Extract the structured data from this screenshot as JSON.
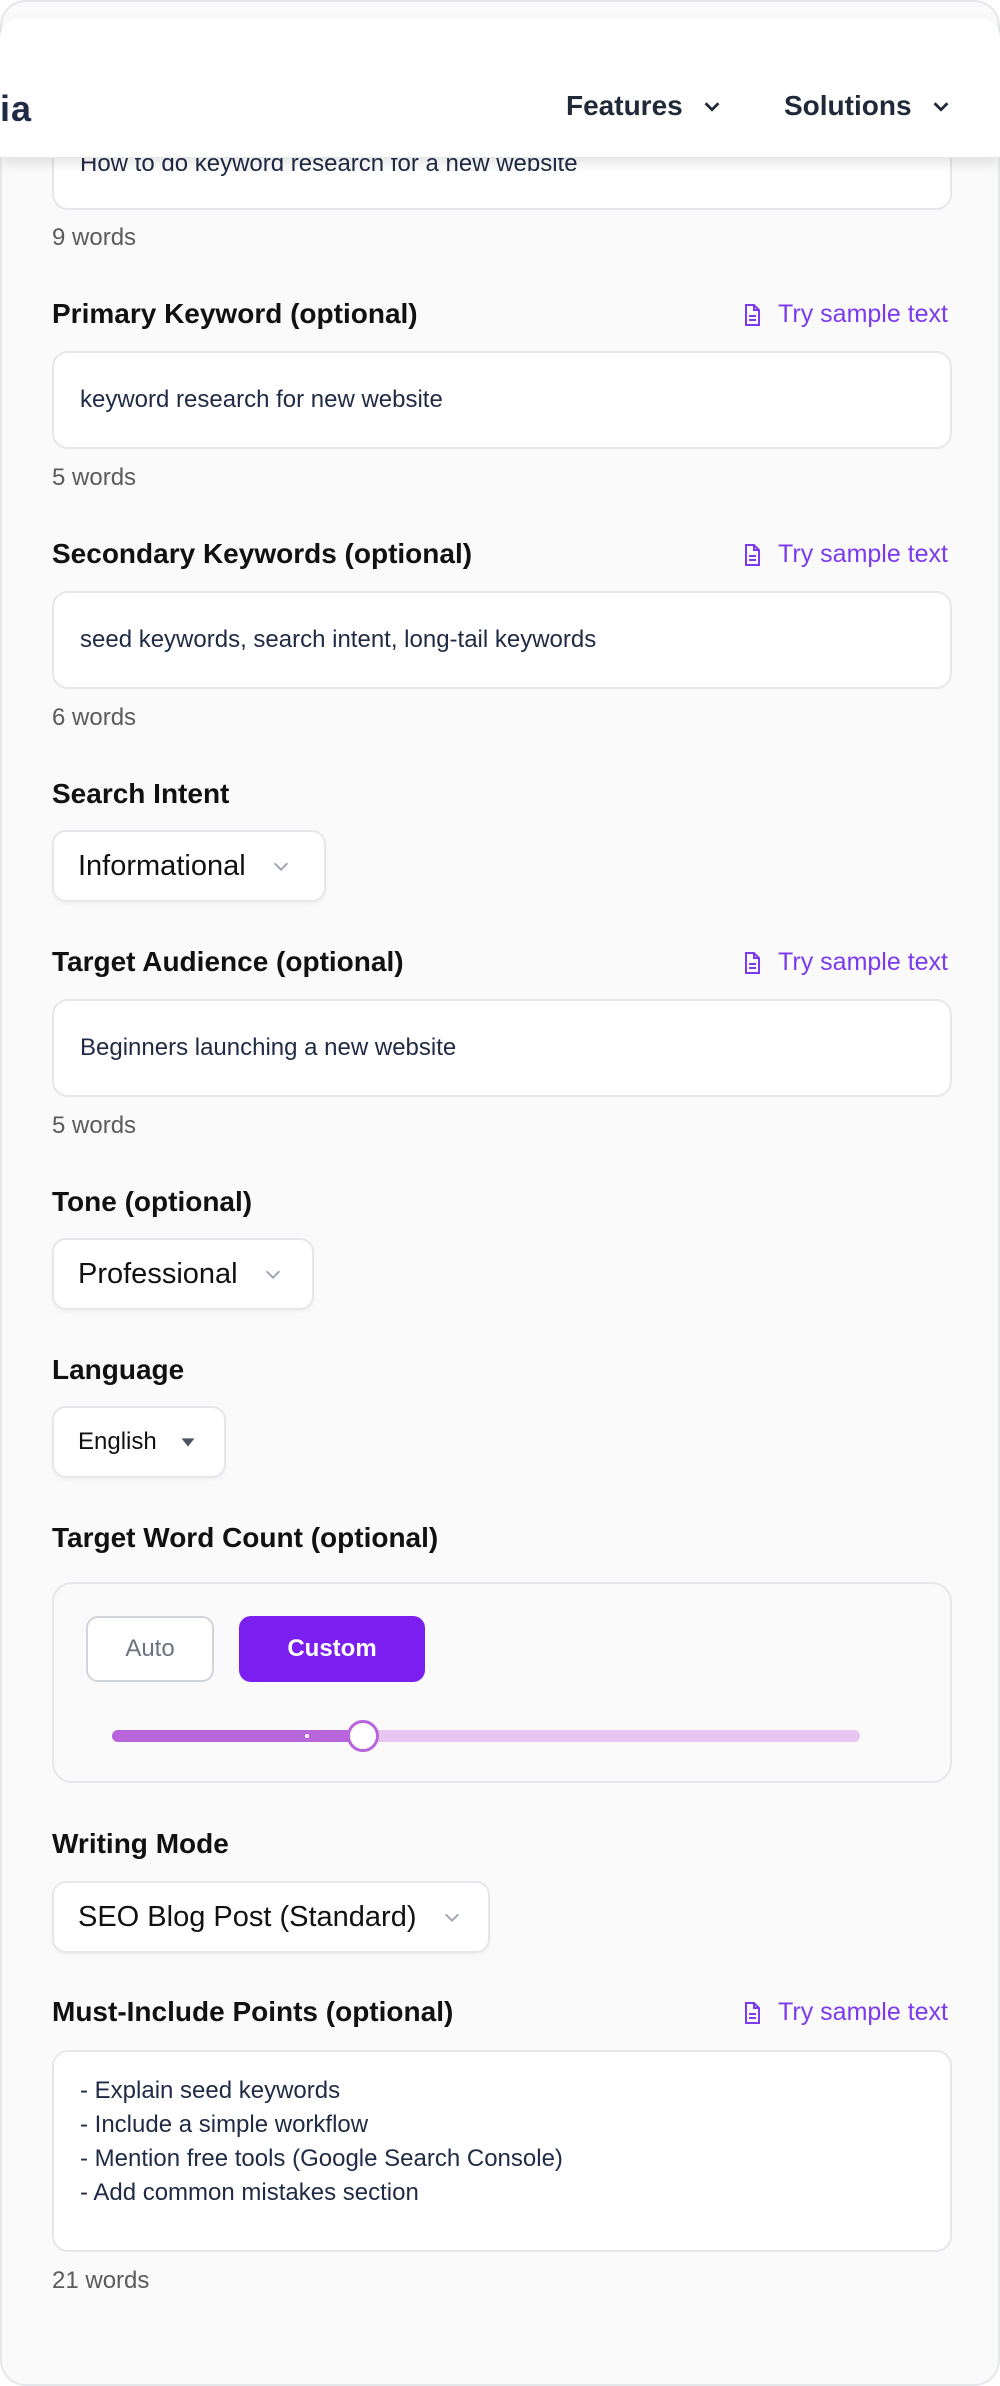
{
  "header": {
    "logo_fragment": "ia",
    "nav": [
      {
        "label": "Features",
        "icon": "chevron-down-icon"
      },
      {
        "label": "Solutions",
        "icon": "chevron-down-icon"
      }
    ]
  },
  "colors": {
    "accent": "#7a1ff0",
    "link": "#7c3aed",
    "slider_fill": "#b865dc",
    "slider_track": "#e8c6f2"
  },
  "form": {
    "title_field": {
      "value_partial": "How to do keyword research for a new website",
      "word_count": "9 words"
    },
    "primary_keyword": {
      "label": "Primary Keyword (optional)",
      "sample": "Try sample text",
      "value": "keyword research for new website",
      "word_count": "5 words"
    },
    "secondary_keywords": {
      "label": "Secondary Keywords (optional)",
      "sample": "Try sample text",
      "value": "seed keywords, search intent, long-tail keywords",
      "word_count": "6 words"
    },
    "search_intent": {
      "label": "Search Intent",
      "selected": "Informational"
    },
    "target_audience": {
      "label": "Target Audience (optional)",
      "sample": "Try sample text",
      "value": "Beginners launching a new website",
      "word_count": "5 words"
    },
    "tone": {
      "label": "Tone (optional)",
      "selected": "Professional"
    },
    "language": {
      "label": "Language",
      "selected": "English"
    },
    "target_word_count": {
      "label": "Target Word Count (optional)",
      "auto_label": "Auto",
      "custom_label": "Custom",
      "mode": "Custom",
      "slider_fraction": 0.335
    },
    "writing_mode": {
      "label": "Writing Mode",
      "selected": "SEO Blog Post (Standard)"
    },
    "must_include": {
      "label": "Must-Include Points (optional)",
      "sample": "Try sample text",
      "lines": [
        "- Explain seed keywords",
        "- Include a simple workflow",
        "- Mention free tools (Google Search Console)",
        "- Add common mistakes section"
      ],
      "word_count": "21 words"
    }
  }
}
